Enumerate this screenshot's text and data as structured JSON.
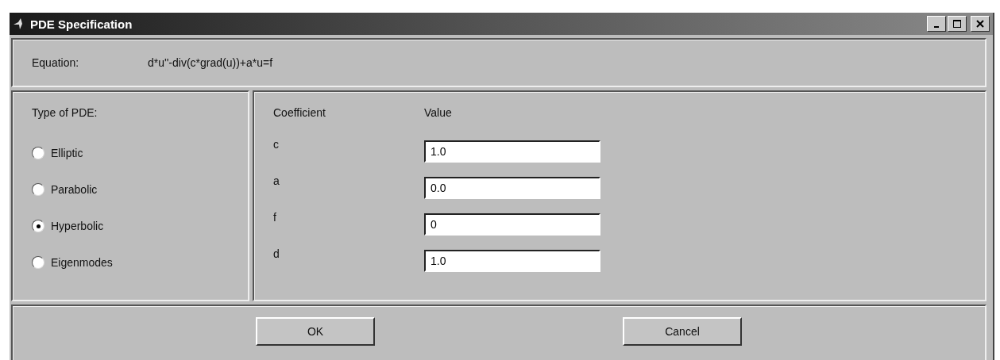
{
  "window": {
    "title": "PDE Specification"
  },
  "equation": {
    "label": "Equation:",
    "value": "d*u''-div(c*grad(u))+a*u=f"
  },
  "pde_type": {
    "label": "Type of PDE:",
    "options": [
      {
        "label": "Elliptic",
        "selected": false
      },
      {
        "label": "Parabolic",
        "selected": false
      },
      {
        "label": "Hyperbolic",
        "selected": true
      },
      {
        "label": "Eigenmodes",
        "selected": false
      }
    ]
  },
  "coefficients": {
    "columns": [
      "Coefficient",
      "Value"
    ],
    "rows": [
      {
        "name": "c",
        "value": "1.0"
      },
      {
        "name": "a",
        "value": "0.0"
      },
      {
        "name": "f",
        "value": "0"
      },
      {
        "name": "d",
        "value": "1.0"
      }
    ]
  },
  "buttons": [
    "OK",
    "Cancel"
  ]
}
